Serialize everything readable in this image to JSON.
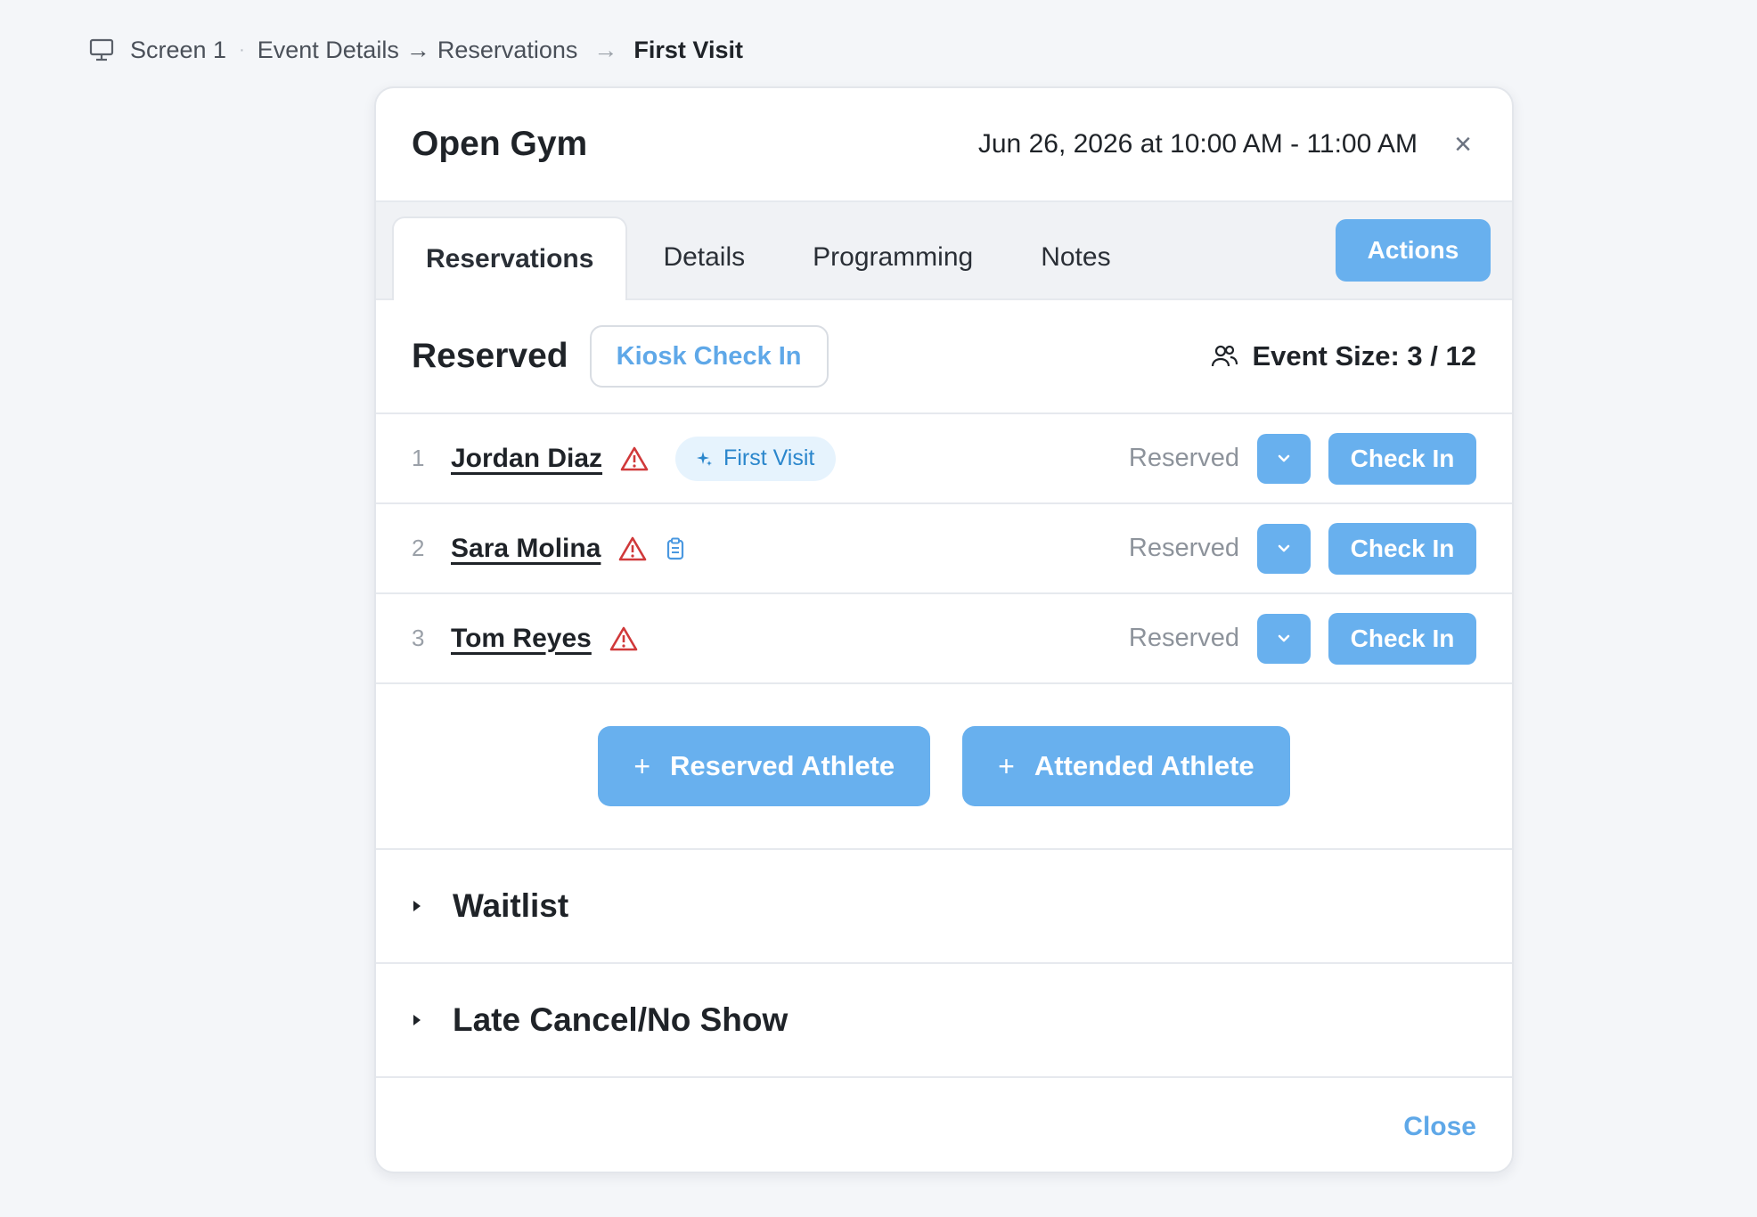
{
  "breadcrumb": {
    "icon": "monitor-icon",
    "screen": "Screen 1",
    "separator": "·",
    "parent": "Event Details",
    "arrow": "→",
    "section": "Reservations",
    "current": "First Visit"
  },
  "modal": {
    "title": "Open Gym",
    "datetime": "Jun 26, 2026 at 10:00 AM - 11:00 AM",
    "close_glyph": "×"
  },
  "tabs": [
    {
      "label": "Reservations",
      "active": true
    },
    {
      "label": "Details"
    },
    {
      "label": "Programming"
    },
    {
      "label": "Notes"
    }
  ],
  "actions_label": "Actions",
  "reserved": {
    "title": "Reserved",
    "kiosk_label": "Kiosk Check In",
    "event_size": "Event Size: 3 / 12"
  },
  "athletes": [
    {
      "num": "1",
      "name": "Jordan Diaz",
      "status": "Reserved",
      "checkin": "Check In",
      "badge": "First Visit"
    },
    {
      "num": "2",
      "name": "Sara Molina",
      "status": "Reserved",
      "checkin": "Check In"
    },
    {
      "num": "3",
      "name": "Tom Reyes",
      "status": "Reserved",
      "checkin": "Check In"
    }
  ],
  "add_buttons": {
    "plus": "+",
    "reserved": "Reserved Athlete",
    "attended": "Attended Athlete"
  },
  "sections": {
    "waitlist": "Waitlist",
    "late_cancel": "Late Cancel/No Show"
  },
  "footer": {
    "close": "Close"
  },
  "colors": {
    "accent": "#68b0ee",
    "accent_text": "#5fa8e8",
    "warning": "#d0393a",
    "badge_bg": "#e6f3fd"
  }
}
